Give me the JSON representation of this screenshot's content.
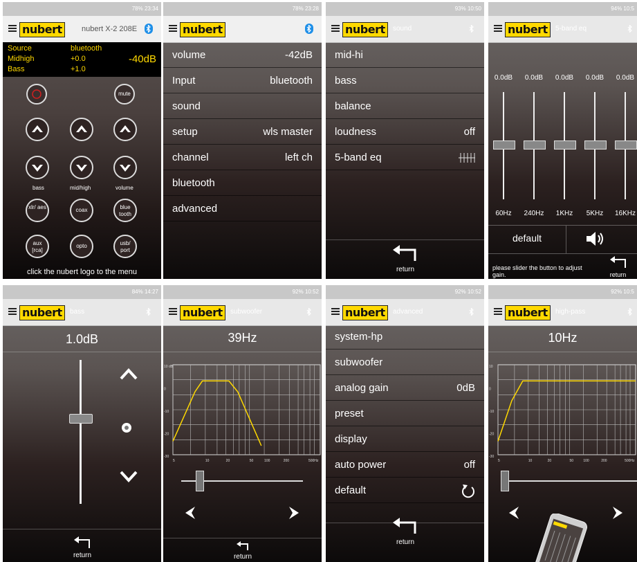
{
  "p1": {
    "status": "78% 23:34",
    "device": "nubert X-2 208E",
    "info": [
      {
        "k": "Source",
        "v": "bluetooth"
      },
      {
        "k": "Midhigh",
        "v": "+0.0"
      },
      {
        "k": "Bass",
        "v": "+1.0"
      }
    ],
    "volume": "-40dB",
    "btn_mute": "mute",
    "lbl_bass": "bass",
    "lbl_midhigh": "mid/high",
    "lbl_volume": "volume",
    "src_xlr": "xlr/ aes",
    "src_coax": "coax",
    "src_bt": "blue tooth",
    "src_aux": "aux [rca]",
    "src_opto": "opto",
    "src_usb": "usb/ port",
    "footer": "click the nubert logo to the menu"
  },
  "p2": {
    "status": "78% 23:28",
    "rows": [
      {
        "label": "volume",
        "value": "-42dB"
      },
      {
        "label": "Input",
        "value": "bluetooth"
      },
      {
        "label": "sound",
        "value": ""
      },
      {
        "label": "setup",
        "value": "wls master"
      },
      {
        "label": "channel",
        "value": "left ch"
      },
      {
        "label": "bluetooth",
        "value": ""
      },
      {
        "label": "advanced",
        "value": ""
      }
    ]
  },
  "p3": {
    "status": "93% 10:50",
    "title": "sound",
    "rows": [
      {
        "label": "mid-hi",
        "value": ""
      },
      {
        "label": "bass",
        "value": ""
      },
      {
        "label": "balance",
        "value": ""
      },
      {
        "label": "loudness",
        "value": "off"
      },
      {
        "label": "5-band eq",
        "value": ""
      }
    ],
    "return": "return"
  },
  "p4": {
    "status": "94% 10:5",
    "title": "5-band eq",
    "gains": [
      "0.0dB",
      "0.0dB",
      "0.0dB",
      "0.0dB",
      "0.0dB"
    ],
    "freqs": [
      "60Hz",
      "240Hz",
      "1KHz",
      "5KHz",
      "16KHz"
    ],
    "default": "default",
    "hint": "please slider the button to adjust gain.",
    "return": "return"
  },
  "p5": {
    "status": "84% 14:27",
    "title": "bass",
    "value": "1.0dB",
    "return": "return"
  },
  "p6": {
    "status": "92% 10:52",
    "title": "subwoofer",
    "value": "39Hz",
    "yticks": [
      "10 dB",
      "0",
      "-10",
      "-20",
      "-30"
    ],
    "xticks": [
      "5",
      "10",
      "20",
      "50",
      "100",
      "200",
      "500Hz"
    ],
    "return": "return"
  },
  "p7": {
    "status": "92% 10:52",
    "title": "advanced",
    "rows": [
      {
        "label": "system-hp",
        "value": ""
      },
      {
        "label": "subwoofer",
        "value": ""
      },
      {
        "label": "analog gain",
        "value": "0dB"
      },
      {
        "label": "preset",
        "value": ""
      },
      {
        "label": "display",
        "value": ""
      },
      {
        "label": "auto power",
        "value": "off"
      },
      {
        "label": "default",
        "value": ""
      }
    ],
    "return": "return"
  },
  "p8": {
    "status": "92% 10:5",
    "title": "high-pass",
    "value": "10Hz",
    "yticks": [
      "10",
      "0",
      "-10",
      "-20",
      "-30"
    ],
    "xticks": [
      "5",
      "10",
      "20",
      "50",
      "100",
      "200",
      "500Hz"
    ]
  },
  "logo": "nubert",
  "accent": "#ffd900",
  "bt_color": "#1e8fe8"
}
